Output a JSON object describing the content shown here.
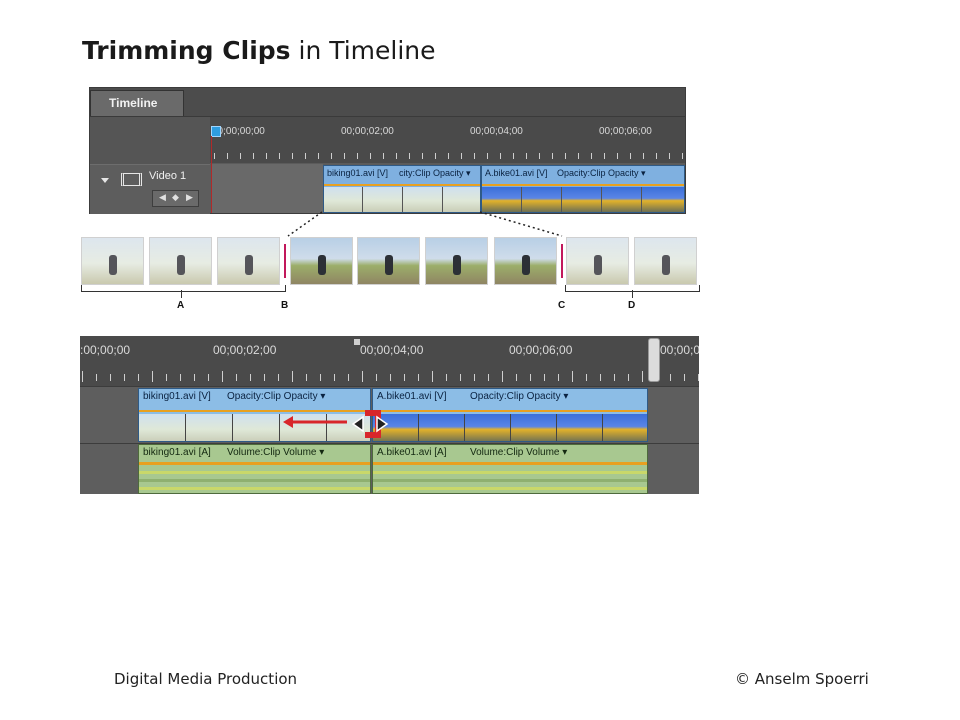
{
  "slide": {
    "title_bold": "Trimming Clips",
    "title_rest": " in Timeline"
  },
  "timeline_panel": {
    "tab": "Timeline",
    "ruler_timecodes": [
      "00;00;00;00",
      "00;00;02;00",
      "00;00;04;00",
      "00;00;06;00"
    ],
    "track_name": "Video 1",
    "clips": [
      {
        "name": "biking01.avi [V]",
        "effect": "city:Clip Opacity ▾"
      },
      {
        "name": "A.bike01.avi [V]",
        "effect": "Opacity:Clip Opacity ▾"
      }
    ]
  },
  "filmstrip": {
    "labels": [
      "A",
      "B",
      "C",
      "D"
    ]
  },
  "zoomed_timeline": {
    "ruler_timecodes": [
      ":00;00;00",
      "00;00;02;00",
      "00;00;04;00",
      "00;00;06;00",
      "00;00;0"
    ],
    "video_clips": [
      {
        "name": "biking01.avi [V]",
        "effect": "Opacity:Clip Opacity ▾"
      },
      {
        "name": "A.bike01.avi [V]",
        "effect": "Opacity:Clip Opacity ▾"
      }
    ],
    "audio_clips": [
      {
        "name": "biking01.avi [A]",
        "effect": "Volume:Clip Volume ▾"
      },
      {
        "name": "A.bike01.avi [A]",
        "effect": "Volume:Clip Volume ▾"
      }
    ]
  },
  "footer": {
    "left": "Digital Media Production",
    "right": "© Anselm Spoerri"
  },
  "colors": {
    "video_clip": "#7fb0e0",
    "audio_clip": "#a8c890",
    "playhead": "#b12a2a",
    "trim_marker": "#c2185b",
    "trim_tool": "#d8262b"
  }
}
